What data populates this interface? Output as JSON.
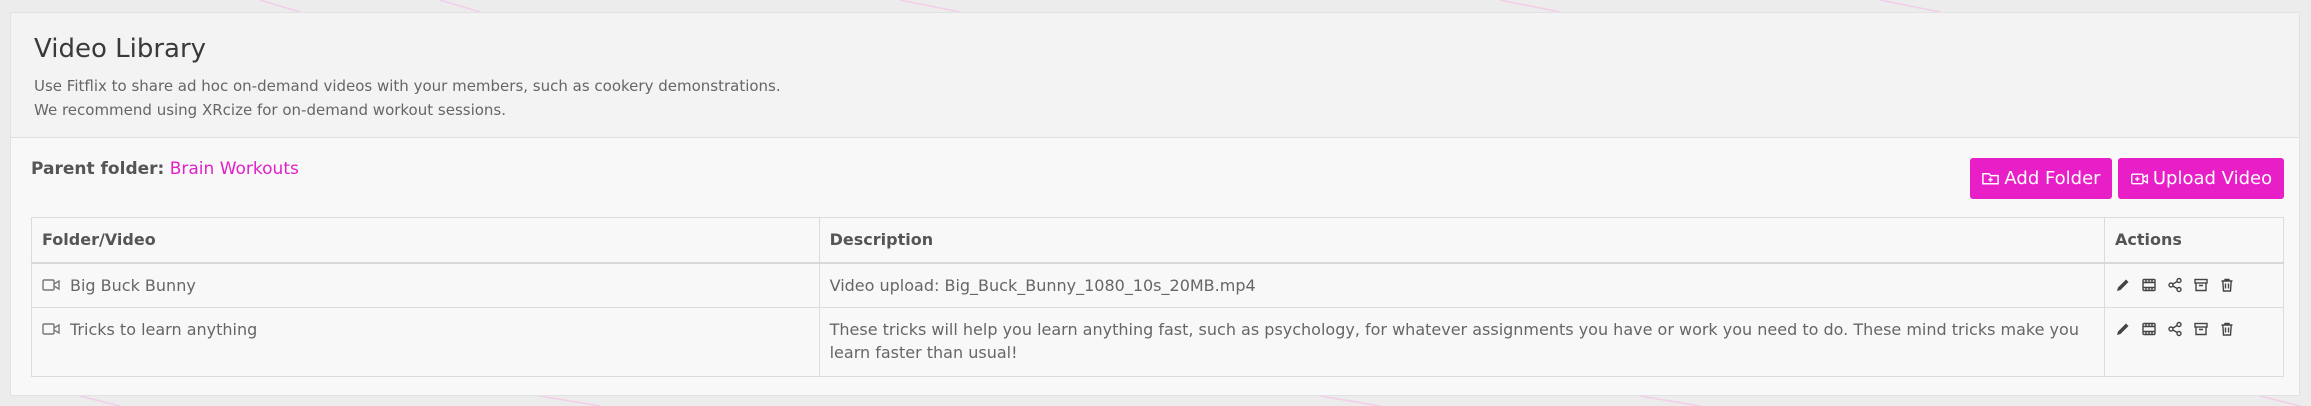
{
  "page": {
    "title": "Video Library",
    "intro_line1": "Use Fitflix to share ad hoc on-demand videos with your members, such as cookery demonstrations.",
    "intro_line2": "We recommend using XRcize for on-demand workout sessions."
  },
  "parent_folder": {
    "label": "Parent folder:",
    "name": "Brain Workouts"
  },
  "toolbar": {
    "add_folder_label": "Add Folder",
    "upload_video_label": "Upload Video"
  },
  "table": {
    "columns": [
      "Folder/Video",
      "Description",
      "Actions"
    ],
    "rows": [
      {
        "name": "Big Buck Bunny",
        "description": "Video upload: Big_Buck_Bunny_1080_10s_20MB.mp4"
      },
      {
        "name": "Tricks to learn anything",
        "description": "These tricks will help you learn anything fast, such as psychology, for whatever assignments you have or work you need to do. These mind tricks make you learn faster than usual!"
      }
    ],
    "row_actions": [
      "edit-icon",
      "film-icon",
      "share-icon",
      "archive-icon",
      "trash-icon"
    ]
  },
  "colors": {
    "accent": "#e81ec7",
    "text": "#666666",
    "header_bg": "#f3f3f3"
  }
}
